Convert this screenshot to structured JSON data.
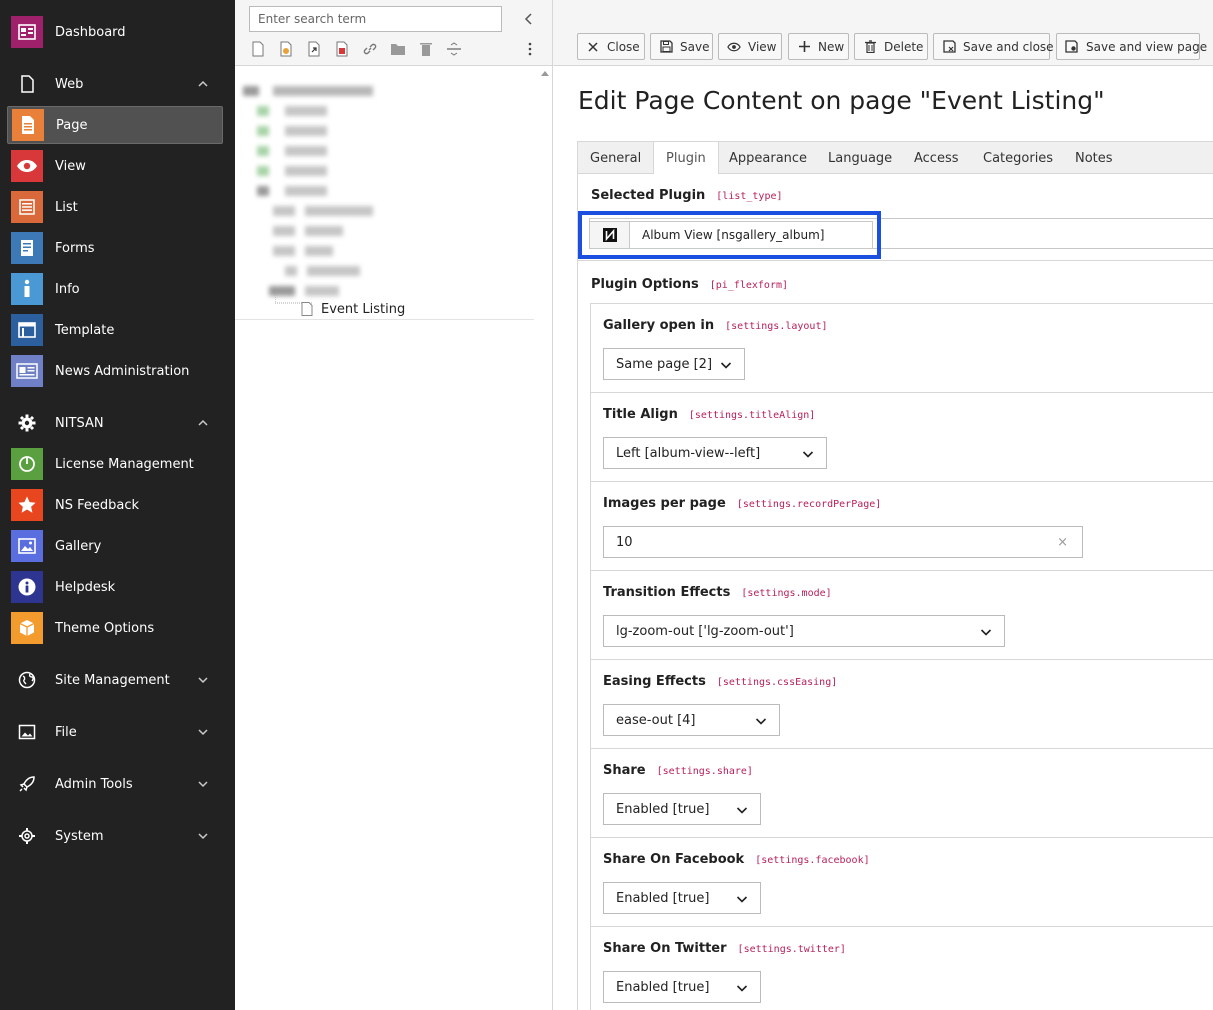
{
  "sidebar": {
    "dashboard": "Dashboard",
    "groups": {
      "web": "Web",
      "nitsan": "NITSAN",
      "site_management": "Site Management",
      "file": "File",
      "admin_tools": "Admin Tools",
      "system": "System"
    },
    "modules": {
      "page": "Page",
      "view": "View",
      "list": "List",
      "forms": "Forms",
      "info": "Info",
      "template": "Template",
      "news": "News Administration",
      "license": "License Management",
      "feedback": "NS Feedback",
      "gallery": "Gallery",
      "helpdesk": "Helpdesk",
      "theme": "Theme Options"
    },
    "colors": {
      "dashboard": "#a0216b",
      "page": "#e9803a",
      "view": "#d9383a",
      "list": "#d9683a",
      "forms": "#3d79b7",
      "info": "#4a99d4",
      "template": "#2c5f9d",
      "news": "#6f80c6",
      "license": "#5a9f40",
      "feedback": "#e8461f",
      "gallery": "#5b6ee0",
      "helpdesk": "#2d3590",
      "theme": "#f39c2d"
    }
  },
  "tree": {
    "search_placeholder": "Enter search term",
    "selected_node": "Event Listing"
  },
  "toolbar": {
    "close": "Close",
    "save": "Save",
    "view": "View",
    "new": "New",
    "delete": "Delete",
    "save_close": "Save and close",
    "save_view": "Save and view page"
  },
  "page": {
    "title": "Edit Page Content on page \"Event Listing\""
  },
  "tabs": [
    "General",
    "Plugin",
    "Appearance",
    "Language",
    "Access",
    "Categories",
    "Notes"
  ],
  "active_tab": "Plugin",
  "plugin": {
    "label": "Selected Plugin",
    "key": "[list_type]",
    "value": "Album View [nsgallery_album]",
    "highlight_color": "#1a4fe0"
  },
  "options": {
    "label": "Plugin Options",
    "key": "[pi_flexform]",
    "fields": [
      {
        "label": "Gallery open in",
        "key": "[settings.layout]",
        "value": "Same page [2]"
      },
      {
        "label": "Title Align",
        "key": "[settings.titleAlign]",
        "value": "Left [album-view--left]"
      },
      {
        "label": "Images per page",
        "key": "[settings.recordPerPage]",
        "value": "10"
      },
      {
        "label": "Transition Effects",
        "key": "[settings.mode]",
        "value": "lg-zoom-out ['lg-zoom-out']"
      },
      {
        "label": "Easing Effects",
        "key": "[settings.cssEasing]",
        "value": "ease-out [4]"
      },
      {
        "label": "Share",
        "key": "[settings.share]",
        "value": "Enabled [true]"
      },
      {
        "label": "Share On Facebook",
        "key": "[settings.facebook]",
        "value": "Enabled [true]"
      },
      {
        "label": "Share On Twitter",
        "key": "[settings.twitter]",
        "value": "Enabled [true]"
      }
    ]
  }
}
